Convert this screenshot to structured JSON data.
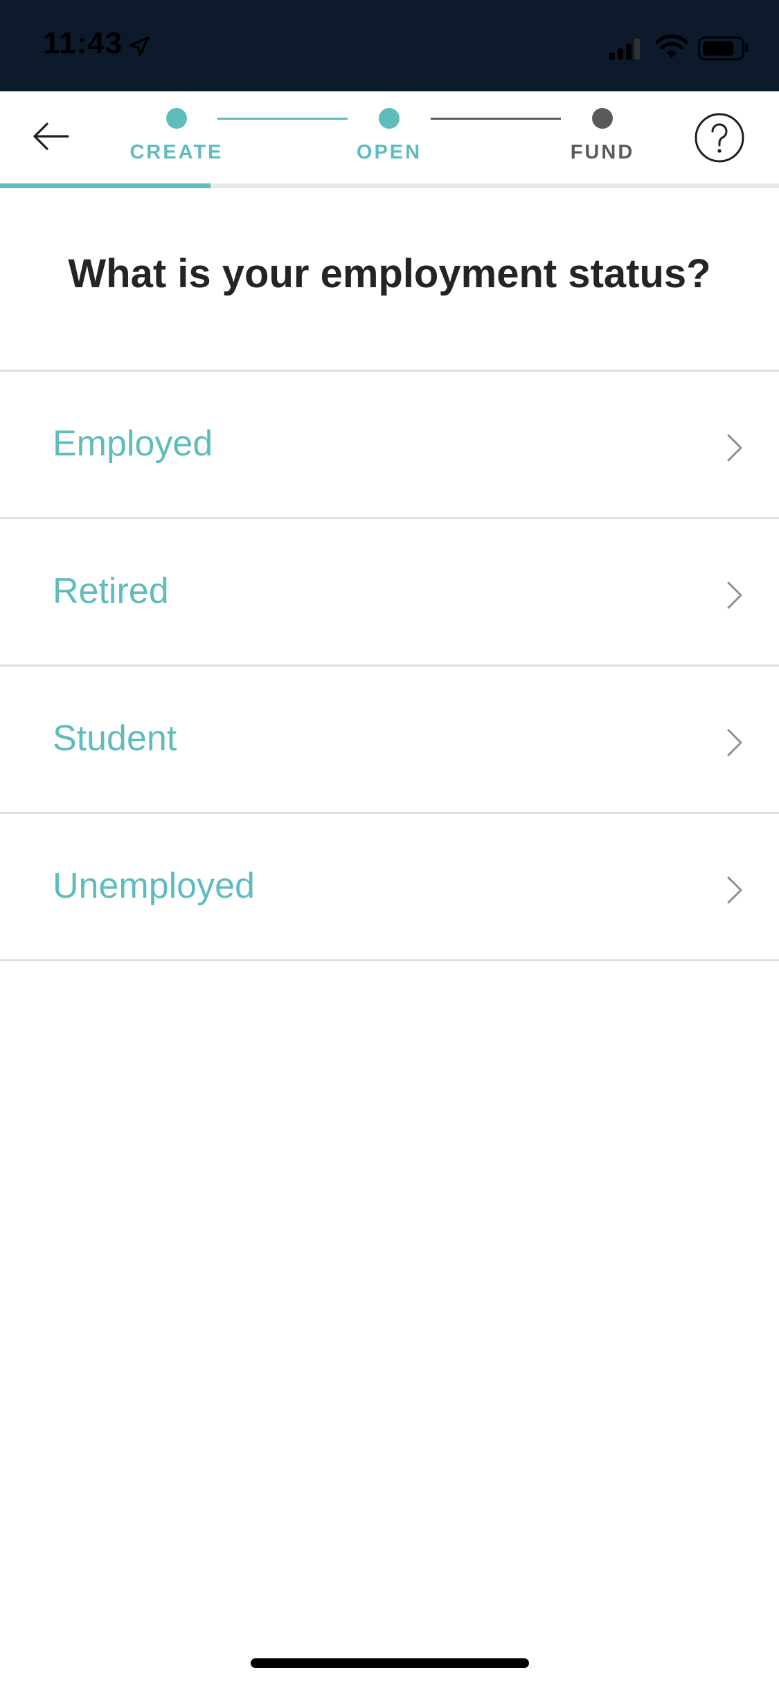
{
  "status_bar": {
    "time": "11:43",
    "location_icon": "location-arrow-icon",
    "signal_icon": "cellular-signal-icon",
    "wifi_icon": "wifi-icon",
    "battery_icon": "battery-icon"
  },
  "nav": {
    "back_icon": "arrow-left-icon",
    "help_icon": "question-circle-icon",
    "steps": [
      {
        "label": "CREATE",
        "state": "completed"
      },
      {
        "label": "OPEN",
        "state": "active"
      },
      {
        "label": "FUND",
        "state": "upcoming"
      }
    ],
    "progress_fraction": 0.27
  },
  "question": "What is your employment status?",
  "options": [
    {
      "label": "Employed"
    },
    {
      "label": "Retired"
    },
    {
      "label": "Student"
    },
    {
      "label": "Unemployed"
    }
  ],
  "colors": {
    "accent": "#5fbcbc",
    "status_bar_bg": "#0c1a2b",
    "text_dark": "#242424",
    "inactive_step": "#5a5a5a",
    "divider": "#dedede",
    "chevron": "#8e8e8e"
  }
}
